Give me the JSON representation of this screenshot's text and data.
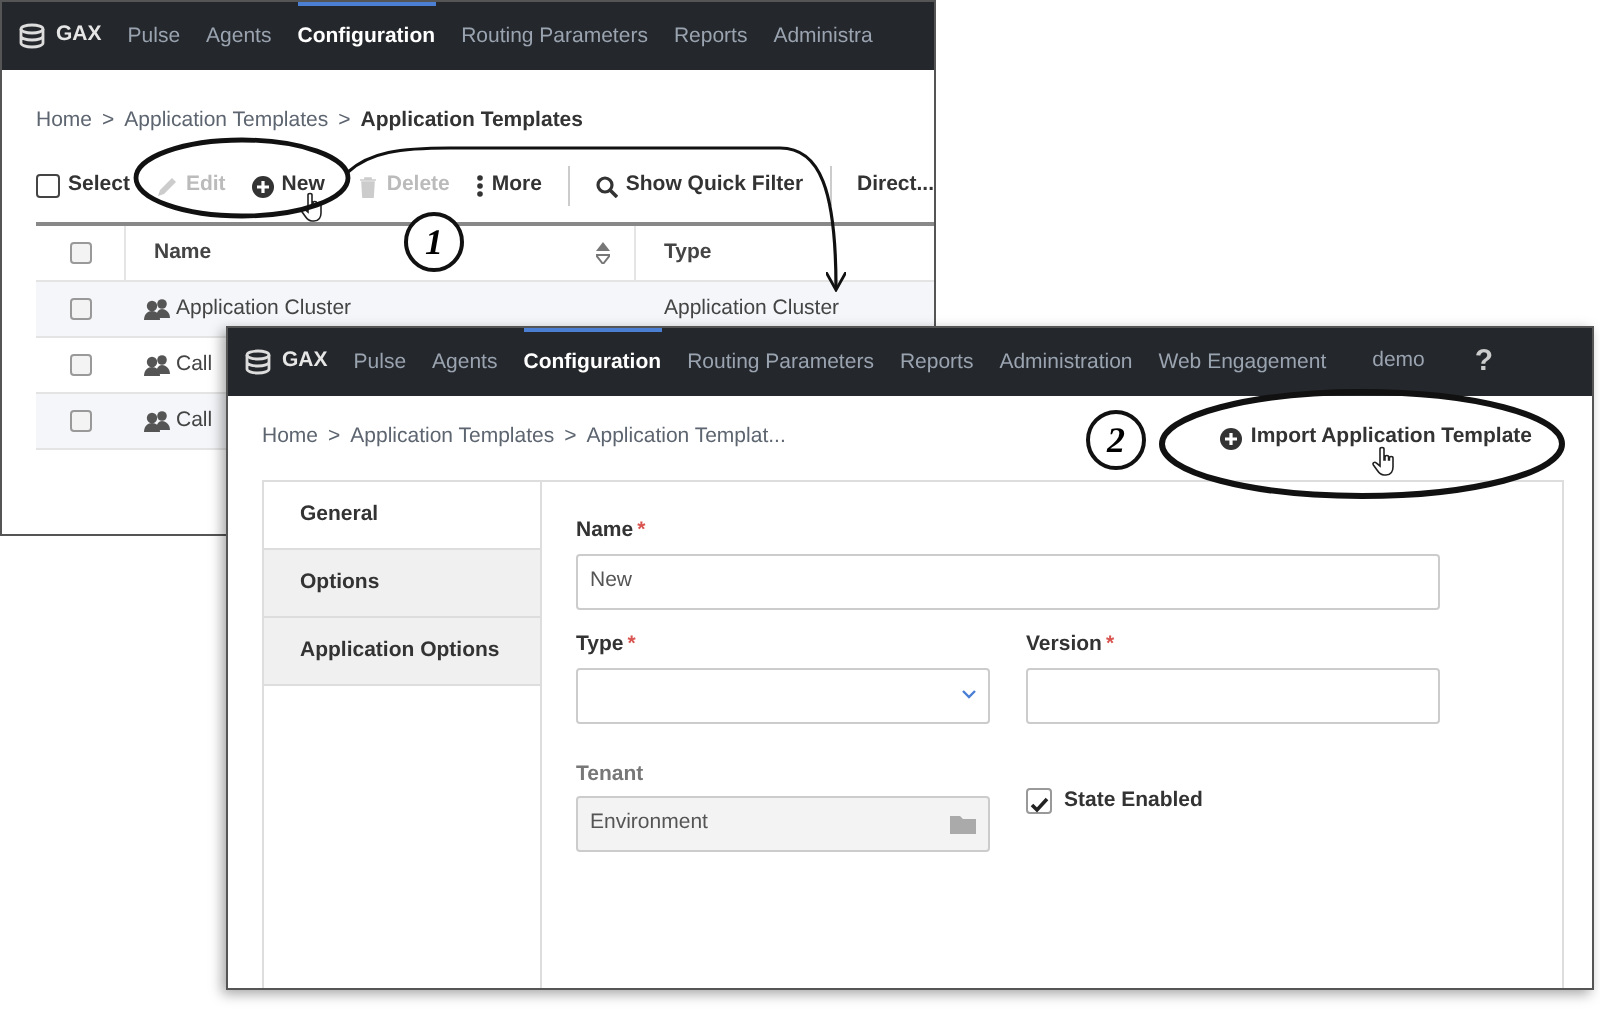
{
  "back_window": {
    "nav": {
      "logo": "GAX",
      "items": [
        {
          "label": "Pulse",
          "selected": false
        },
        {
          "label": "Agents",
          "selected": false
        },
        {
          "label": "Configuration",
          "selected": true
        },
        {
          "label": "Routing Parameters",
          "selected": false
        },
        {
          "label": "Reports",
          "selected": false
        },
        {
          "label": "Administra",
          "selected": false
        }
      ]
    },
    "breadcrumb": {
      "separator": ">",
      "items": [
        {
          "label": "Home",
          "bold": false
        },
        {
          "label": "Application Templates",
          "bold": false
        },
        {
          "label": "Application Templates",
          "bold": true
        }
      ]
    },
    "toolbar": {
      "select": {
        "label": "Select",
        "checked": false
      },
      "actions": [
        {
          "kind": "edit",
          "label": "Edit",
          "disabled": true
        },
        {
          "kind": "new",
          "label": "New",
          "disabled": false
        },
        {
          "kind": "delete",
          "label": "Delete",
          "disabled": true
        },
        {
          "kind": "more",
          "label": "More",
          "disabled": false
        }
      ],
      "filter": "Show Quick Filter",
      "directory": "Direct..."
    },
    "table": {
      "header_checked": false,
      "columns": [
        "Name",
        "Type"
      ],
      "rows": [
        {
          "name": "Application Cluster",
          "type": "Application Cluster",
          "checked": false
        },
        {
          "name": "Call",
          "type": "",
          "checked": false
        },
        {
          "name": "Call",
          "type": "",
          "checked": false
        }
      ]
    }
  },
  "front_window": {
    "nav": {
      "logo": "GAX",
      "items": [
        {
          "label": "Pulse",
          "selected": false
        },
        {
          "label": "Agents",
          "selected": false
        },
        {
          "label": "Configuration",
          "selected": true
        },
        {
          "label": "Routing Parameters",
          "selected": false
        },
        {
          "label": "Reports",
          "selected": false
        },
        {
          "label": "Administration",
          "selected": false
        },
        {
          "label": "Web Engagement",
          "selected": false
        }
      ],
      "user": "demo",
      "help": "?"
    },
    "breadcrumb": {
      "separator": ">",
      "items": [
        {
          "label": "Home",
          "bold": false
        },
        {
          "label": "Application Templates",
          "bold": false
        },
        {
          "label": "Application Templat...",
          "bold": false
        }
      ]
    },
    "import_button": "Import Application Template",
    "tabs": [
      {
        "label": "General",
        "selected": true
      },
      {
        "label": "Options",
        "selected": false
      },
      {
        "label": "Application Options",
        "selected": false
      }
    ],
    "form": {
      "required_mark": "*",
      "name": {
        "label": "Name",
        "required": true,
        "value": "New"
      },
      "type": {
        "label": "Type",
        "required": true
      },
      "version": {
        "label": "Version",
        "required": true
      },
      "tenant": {
        "label": "Tenant",
        "value": "Environment",
        "disabled": true
      },
      "state": {
        "label": "State Enabled",
        "checked": true
      }
    }
  },
  "annotations": [
    {
      "number": "1"
    },
    {
      "number": "2"
    }
  ]
}
